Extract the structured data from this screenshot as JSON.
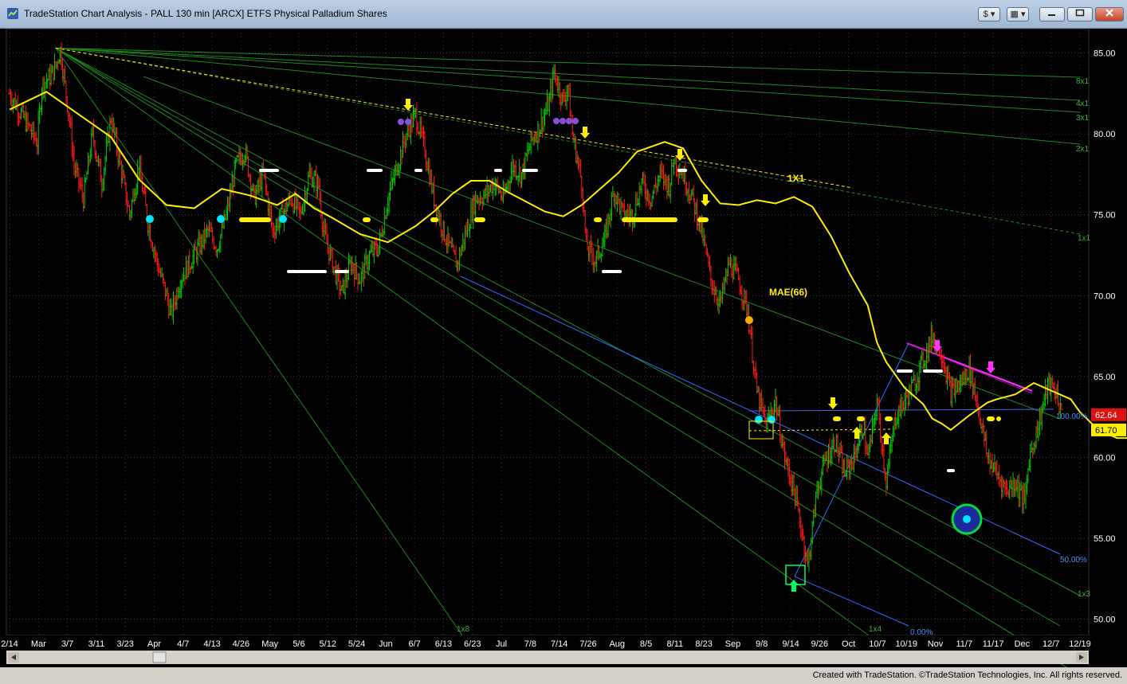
{
  "window": {
    "title": "TradeStation Chart Analysis - PALL 130 min [ARCX] ETFS Physical Palladium Shares",
    "btn_s": "$",
    "btn_grid": "▦"
  },
  "chart_data": {
    "type": "candlestick",
    "symbol": "PALL",
    "interval": "130 min",
    "ylim": [
      49,
      86.5
    ],
    "y_ticks": [
      "85.00",
      "80.00",
      "75.00",
      "70.00",
      "65.00",
      "60.00",
      "55.00",
      "50.00"
    ],
    "x_ticks": [
      "2/14",
      "Mar",
      "3/7",
      "3/11",
      "3/23",
      "Apr",
      "4/7",
      "4/13",
      "4/26",
      "May",
      "5/6",
      "5/12",
      "5/24",
      "Jun",
      "6/7",
      "6/13",
      "6/23",
      "Jul",
      "7/8",
      "7/14",
      "7/26",
      "Aug",
      "8/5",
      "8/11",
      "8/23",
      "Sep",
      "9/8",
      "9/14",
      "9/26",
      "Oct",
      "10/7",
      "10/19",
      "Nov",
      "11/7",
      "11/17",
      "Dec",
      "12/7",
      "12/19"
    ],
    "price_path": [
      [
        0,
        82.5
      ],
      [
        3,
        81
      ],
      [
        6,
        79.5
      ],
      [
        7,
        83
      ],
      [
        9,
        83.6
      ],
      [
        10,
        84.2
      ],
      [
        11,
        85.2
      ],
      [
        13,
        80.8
      ],
      [
        14,
        78
      ],
      [
        16,
        76
      ],
      [
        18,
        80
      ],
      [
        20,
        77
      ],
      [
        22,
        81
      ],
      [
        24,
        78
      ],
      [
        26,
        75
      ],
      [
        28,
        78
      ],
      [
        30,
        74.5
      ],
      [
        32,
        72
      ],
      [
        34,
        70
      ],
      [
        35,
        68.8
      ],
      [
        37,
        71
      ],
      [
        39,
        72
      ],
      [
        41,
        73
      ],
      [
        43,
        74
      ],
      [
        45,
        73
      ],
      [
        47,
        75
      ],
      [
        49,
        78
      ],
      [
        51,
        79
      ],
      [
        53,
        76
      ],
      [
        55,
        77.5
      ],
      [
        57,
        74
      ],
      [
        59,
        75
      ],
      [
        61,
        76
      ],
      [
        63,
        75
      ],
      [
        65,
        77.5
      ],
      [
        67,
        76.8
      ],
      [
        68,
        74
      ],
      [
        70,
        72
      ],
      [
        72,
        70.2
      ],
      [
        74,
        72
      ],
      [
        76,
        71
      ],
      [
        78,
        72.5
      ],
      [
        80,
        73
      ],
      [
        82,
        76
      ],
      [
        84,
        78
      ],
      [
        86,
        80
      ],
      [
        88,
        81.2
      ],
      [
        90,
        79
      ],
      [
        92,
        76
      ],
      [
        94,
        74
      ],
      [
        96,
        72.5
      ],
      [
        97,
        72
      ],
      [
        99,
        74
      ],
      [
        101,
        76
      ],
      [
        103,
        76.2
      ],
      [
        105,
        77
      ],
      [
        107,
        76
      ],
      [
        109,
        78
      ],
      [
        111,
        77.5
      ],
      [
        113,
        79.5
      ],
      [
        115,
        80.5
      ],
      [
        117,
        82
      ],
      [
        118,
        83.8
      ],
      [
        120,
        82
      ],
      [
        121,
        83
      ],
      [
        122,
        80
      ],
      [
        124,
        77
      ],
      [
        125,
        73
      ],
      [
        127,
        72.2
      ],
      [
        129,
        73.5
      ],
      [
        131,
        76.5
      ],
      [
        133,
        75
      ],
      [
        135,
        75
      ],
      [
        137,
        77
      ],
      [
        139,
        76
      ],
      [
        141,
        77.5
      ],
      [
        143,
        76.8
      ],
      [
        144,
        78.5
      ],
      [
        146,
        77.5
      ],
      [
        148,
        76
      ],
      [
        150,
        74
      ],
      [
        152,
        71
      ],
      [
        154,
        69.5
      ],
      [
        156,
        72
      ],
      [
        158,
        71
      ],
      [
        160,
        69
      ],
      [
        162,
        64
      ],
      [
        164,
        62
      ],
      [
        166,
        63.5
      ],
      [
        168,
        60
      ],
      [
        170,
        58
      ],
      [
        172,
        55
      ],
      [
        173,
        53.3
      ],
      [
        175,
        58
      ],
      [
        177,
        60
      ],
      [
        179,
        61
      ],
      [
        181,
        59
      ],
      [
        183,
        60
      ],
      [
        185,
        62
      ],
      [
        186,
        60
      ],
      [
        187,
        61.5
      ],
      [
        188,
        63.5
      ],
      [
        190,
        58.5
      ],
      [
        192,
        62.5
      ],
      [
        194,
        63.5
      ],
      [
        196,
        64.5
      ],
      [
        198,
        66
      ],
      [
        200,
        67.5
      ],
      [
        202,
        66.5
      ],
      [
        204,
        64
      ],
      [
        206,
        64.5
      ],
      [
        208,
        65.5
      ],
      [
        210,
        63
      ],
      [
        212,
        60
      ],
      [
        214,
        59
      ],
      [
        216,
        58
      ],
      [
        218,
        58.5
      ],
      [
        220,
        57.2
      ],
      [
        221,
        60
      ],
      [
        223,
        62
      ],
      [
        225,
        64.5
      ],
      [
        227,
        64
      ],
      [
        228,
        62.6
      ]
    ],
    "series": [
      {
        "name": "MAE(66)",
        "values": [
          [
            0,
            81.5
          ],
          [
            4,
            82.6
          ],
          [
            7,
            81.4
          ],
          [
            11,
            79.8
          ],
          [
            14,
            77.2
          ],
          [
            17,
            75.6
          ],
          [
            20,
            75.4
          ],
          [
            23,
            76.6
          ],
          [
            26,
            76.2
          ],
          [
            29,
            75.6
          ],
          [
            31,
            76.3
          ],
          [
            33,
            75.4
          ],
          [
            35,
            74.8
          ],
          [
            38,
            73.8
          ],
          [
            41,
            73.3
          ],
          [
            44,
            74.3
          ],
          [
            46,
            75.2
          ],
          [
            48,
            76.3
          ],
          [
            50,
            77.1
          ],
          [
            52,
            77.1
          ],
          [
            54,
            76.4
          ],
          [
            56,
            75.8
          ],
          [
            58,
            75.2
          ],
          [
            60,
            74.9
          ],
          [
            62,
            75.6
          ],
          [
            64,
            76.6
          ],
          [
            66,
            77.6
          ],
          [
            68,
            78.9
          ],
          [
            71,
            79.5
          ],
          [
            73,
            79.1
          ],
          [
            75,
            77.1
          ],
          [
            77,
            75.7
          ],
          [
            79,
            75.6
          ],
          [
            81,
            75.9
          ],
          [
            83,
            75.7
          ],
          [
            85,
            76.1
          ],
          [
            87,
            75.5
          ],
          [
            89,
            73.7
          ],
          [
            91,
            71.4
          ],
          [
            93,
            69.4
          ],
          [
            94,
            67.1
          ],
          [
            95,
            65.9
          ],
          [
            97,
            64.3
          ],
          [
            99,
            63.3
          ],
          [
            100,
            62.4
          ],
          [
            101,
            62.1
          ],
          [
            102,
            61.7
          ],
          [
            104,
            62.6
          ],
          [
            106,
            63.4
          ],
          [
            107,
            63.6
          ],
          [
            109,
            63.9
          ],
          [
            111,
            64.6
          ],
          [
            113,
            64.1
          ],
          [
            115,
            63.6
          ],
          [
            116,
            62.8
          ],
          [
            118,
            61.7
          ],
          [
            120,
            61.2
          ],
          [
            121,
            61.2
          ],
          [
            123,
            61.9
          ]
        ],
        "sx": 0.5
      },
      {
        "name": "Close",
        "values": [
          [
            0,
            62.64
          ]
        ]
      }
    ],
    "last_price": "62.64",
    "mae_value": "61.70",
    "gann_labels": [
      "8x1",
      "4x1",
      "3x1",
      "2x1",
      "1x1",
      "1x3",
      "1x4",
      "1x8"
    ],
    "gann_1x1_label": "1X1",
    "mae_label": "MAE(66)",
    "fib_labels": [
      "100.00%",
      "50.00%",
      "0.00%"
    ],
    "colors": {
      "up": "#00cc00",
      "down": "#ff1a1a",
      "mae": "#ffee00",
      "gann": "#1e8a1e",
      "fib": "#2a6cff",
      "magenta": "#ff33ff",
      "grid": "#3a3a3a"
    }
  },
  "status": {
    "text": "Created with TradeStation. ©TradeStation Technologies, Inc. All rights reserved."
  }
}
